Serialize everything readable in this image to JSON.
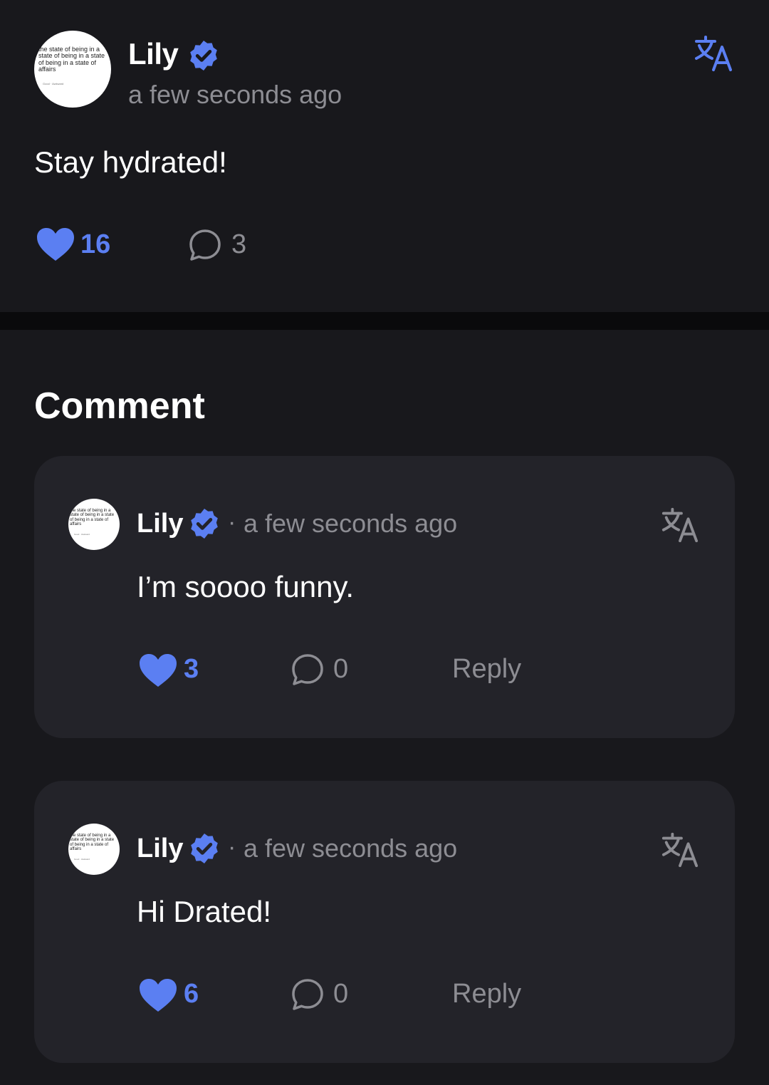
{
  "post": {
    "avatar_text": "the state of being in a state of being in a state of being in a state of affairs",
    "avatar_footer": "Good · Awkward",
    "author": "Lily",
    "time": "a few seconds ago",
    "body": "Stay hydrated!",
    "likes": "16",
    "comments": "3"
  },
  "section_title": "Comment",
  "comments": [
    {
      "avatar_text": "the state of being in a state of being in a state of being in a state of affairs",
      "avatar_footer": "Good · Awkward",
      "author": "Lily",
      "dot": "·",
      "time": "a few seconds ago",
      "body": "I’m soooo funny.",
      "likes": "3",
      "replies": "0",
      "reply_label": "Reply"
    },
    {
      "avatar_text": "the state of being in a state of being in a state of being in a state of affairs",
      "avatar_footer": "Good · Awkward",
      "author": "Lily",
      "dot": "·",
      "time": "a few seconds ago",
      "body": "Hi Drated!",
      "likes": "6",
      "replies": "0",
      "reply_label": "Reply"
    }
  ],
  "colors": {
    "accent": "#5b7ff2",
    "background": "#18181c",
    "card": "#232329",
    "muted": "#8d8d93"
  },
  "icons": {
    "verified": "verified-badge-icon",
    "translate": "translate-icon",
    "like": "heart-icon",
    "comment": "speech-bubble-icon"
  }
}
